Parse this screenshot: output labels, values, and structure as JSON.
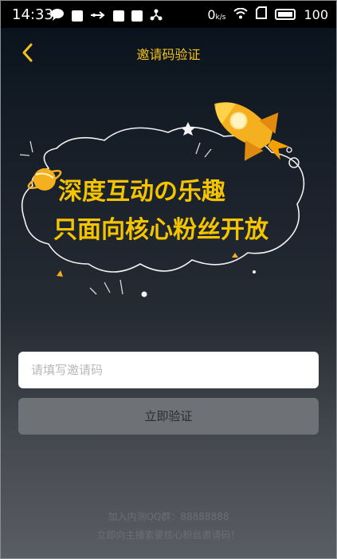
{
  "status_bar": {
    "time": "14:33",
    "signal_text": "0",
    "signal_unit": "k/s",
    "battery": "100"
  },
  "header": {
    "title": "邀请码验证",
    "accent_color": "#f3c21b"
  },
  "banner": {
    "line1": "深度互动の乐趣",
    "line2": "只面向核心粉丝开放"
  },
  "form": {
    "placeholder": "请填写邀请码",
    "submit_label": "立即验证"
  },
  "footer": {
    "line1": "加入内测QQ群：88888888",
    "line2": "立即向主播索要核心粉丝邀请码！"
  }
}
